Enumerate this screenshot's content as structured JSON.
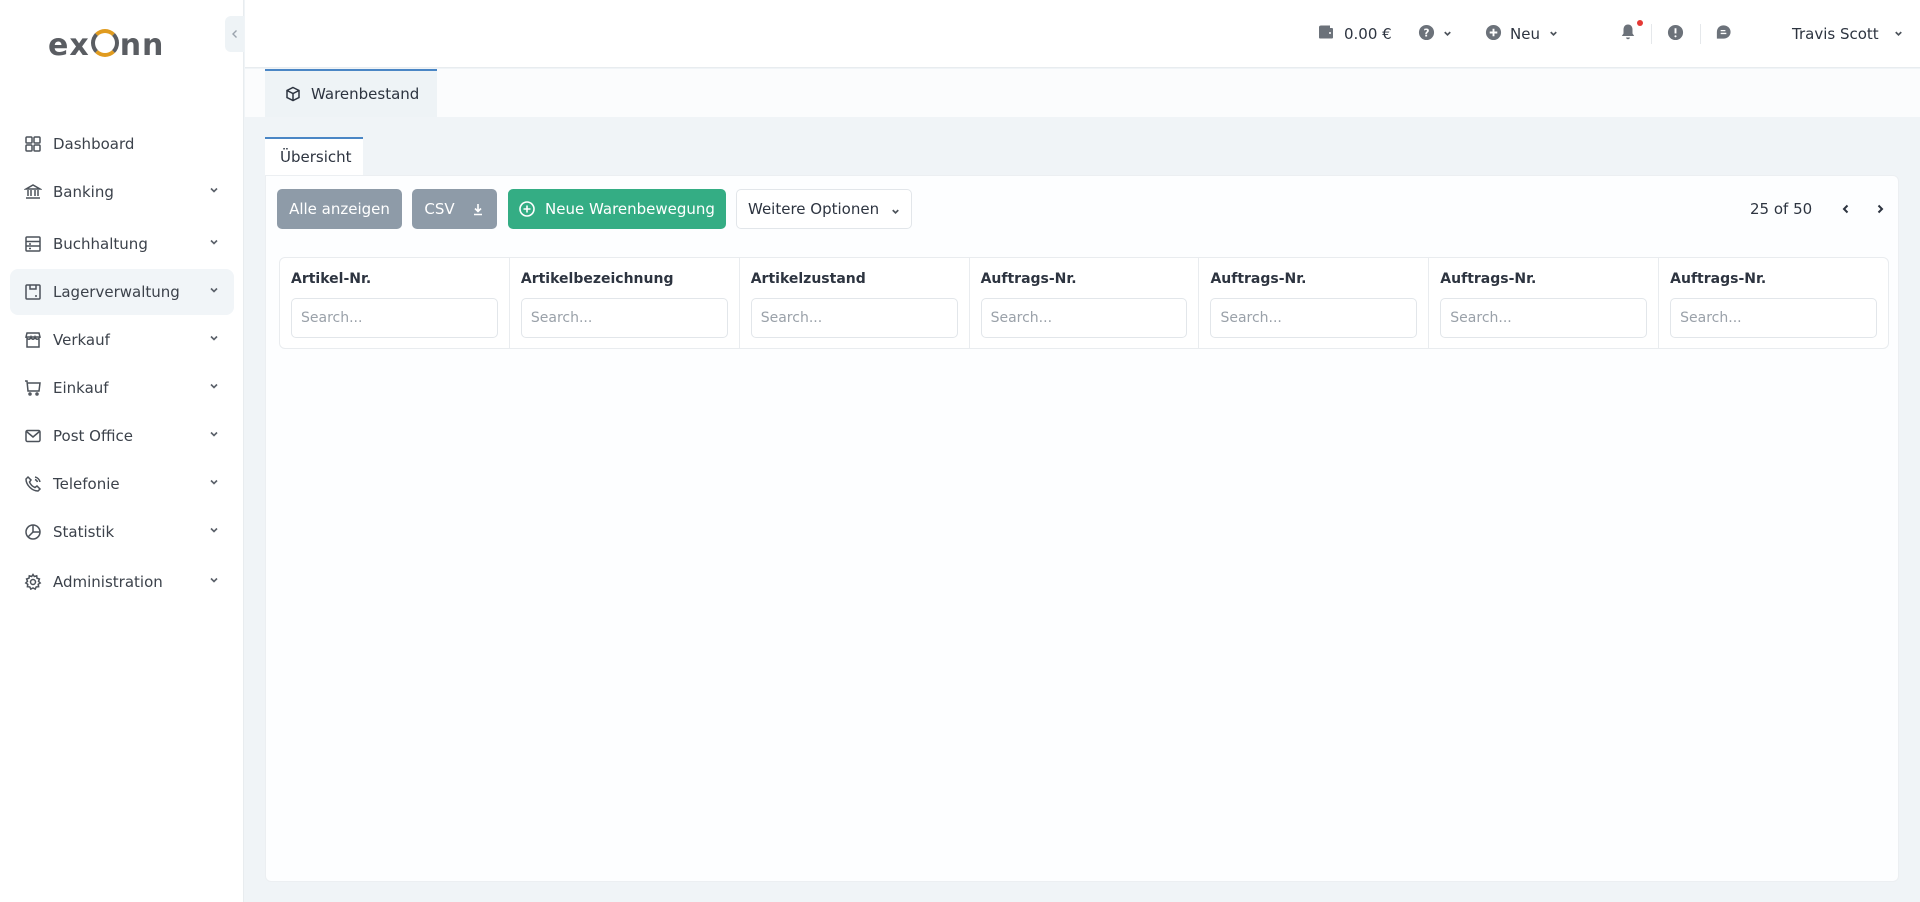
{
  "brand": {
    "logo_text_left": "ex",
    "logo_text_right": "nn"
  },
  "sidebar": {
    "collapse_icon": "chevron-left-icon",
    "items": [
      {
        "label": "Dashboard",
        "icon": "grid-icon",
        "has_chevron": false,
        "active": false
      },
      {
        "label": "Banking",
        "icon": "bank-icon",
        "has_chevron": true,
        "active": false
      },
      {
        "label": "Buchhaltung",
        "icon": "ledger-icon",
        "has_chevron": true,
        "active": false
      },
      {
        "label": "Lagerverwaltung",
        "icon": "box-icon",
        "has_chevron": true,
        "active": true
      },
      {
        "label": "Verkauf",
        "icon": "store-icon",
        "has_chevron": true,
        "active": false
      },
      {
        "label": "Einkauf",
        "icon": "cart-icon",
        "has_chevron": true,
        "active": false
      },
      {
        "label": "Post Office",
        "icon": "mail-icon",
        "has_chevron": true,
        "active": false
      },
      {
        "label": "Telefonie",
        "icon": "phone-icon",
        "has_chevron": true,
        "active": false
      },
      {
        "label": "Statistik",
        "icon": "pie-chart-icon",
        "has_chevron": true,
        "active": false
      },
      {
        "label": "Administration",
        "icon": "gear-icon",
        "has_chevron": true,
        "active": false
      }
    ]
  },
  "header": {
    "balance": "0.00 €",
    "balance_icon": "wallet-icon",
    "help_icon": "help-icon",
    "new_label": "Neu",
    "new_icon": "plus-circle-icon",
    "notification_icon": "bell-icon",
    "notification_unread": true,
    "alert_icon": "alert-icon",
    "chat_icon": "chat-icon",
    "user_name": "Travis Scott"
  },
  "page": {
    "tab_label": "Warenbestand",
    "tab_icon": "cube-icon",
    "subtab_label": "Übersicht"
  },
  "toolbar": {
    "show_all_label": "Alle anzeigen",
    "csv_label": "CSV",
    "new_movement_label": "Neue Warenbewegung",
    "more_options_label": "Weitere Optionen",
    "pagination_text": "25 of 50"
  },
  "colors": {
    "primary_green": "#34ad84",
    "button_grey": "#8e9ba8",
    "tab_accent": "#4a86c5",
    "notification_dot": "#e53935",
    "logo_orange": "#e09b1f"
  },
  "table": {
    "columns": [
      {
        "header": "Artikel-Nr.",
        "placeholder": "Search...",
        "value": ""
      },
      {
        "header": "Artikelbezeichnung",
        "placeholder": "Search...",
        "value": ""
      },
      {
        "header": "Artikelzustand",
        "placeholder": "Search...",
        "value": ""
      },
      {
        "header": "Auftrags-Nr.",
        "placeholder": "Search...",
        "value": ""
      },
      {
        "header": "Auftrags-Nr.",
        "placeholder": "Search...",
        "value": ""
      },
      {
        "header": "Auftrags-Nr.",
        "placeholder": "Search...",
        "value": ""
      },
      {
        "header": "Auftrags-Nr.",
        "placeholder": "Search...",
        "value": ""
      }
    ],
    "rows": []
  }
}
